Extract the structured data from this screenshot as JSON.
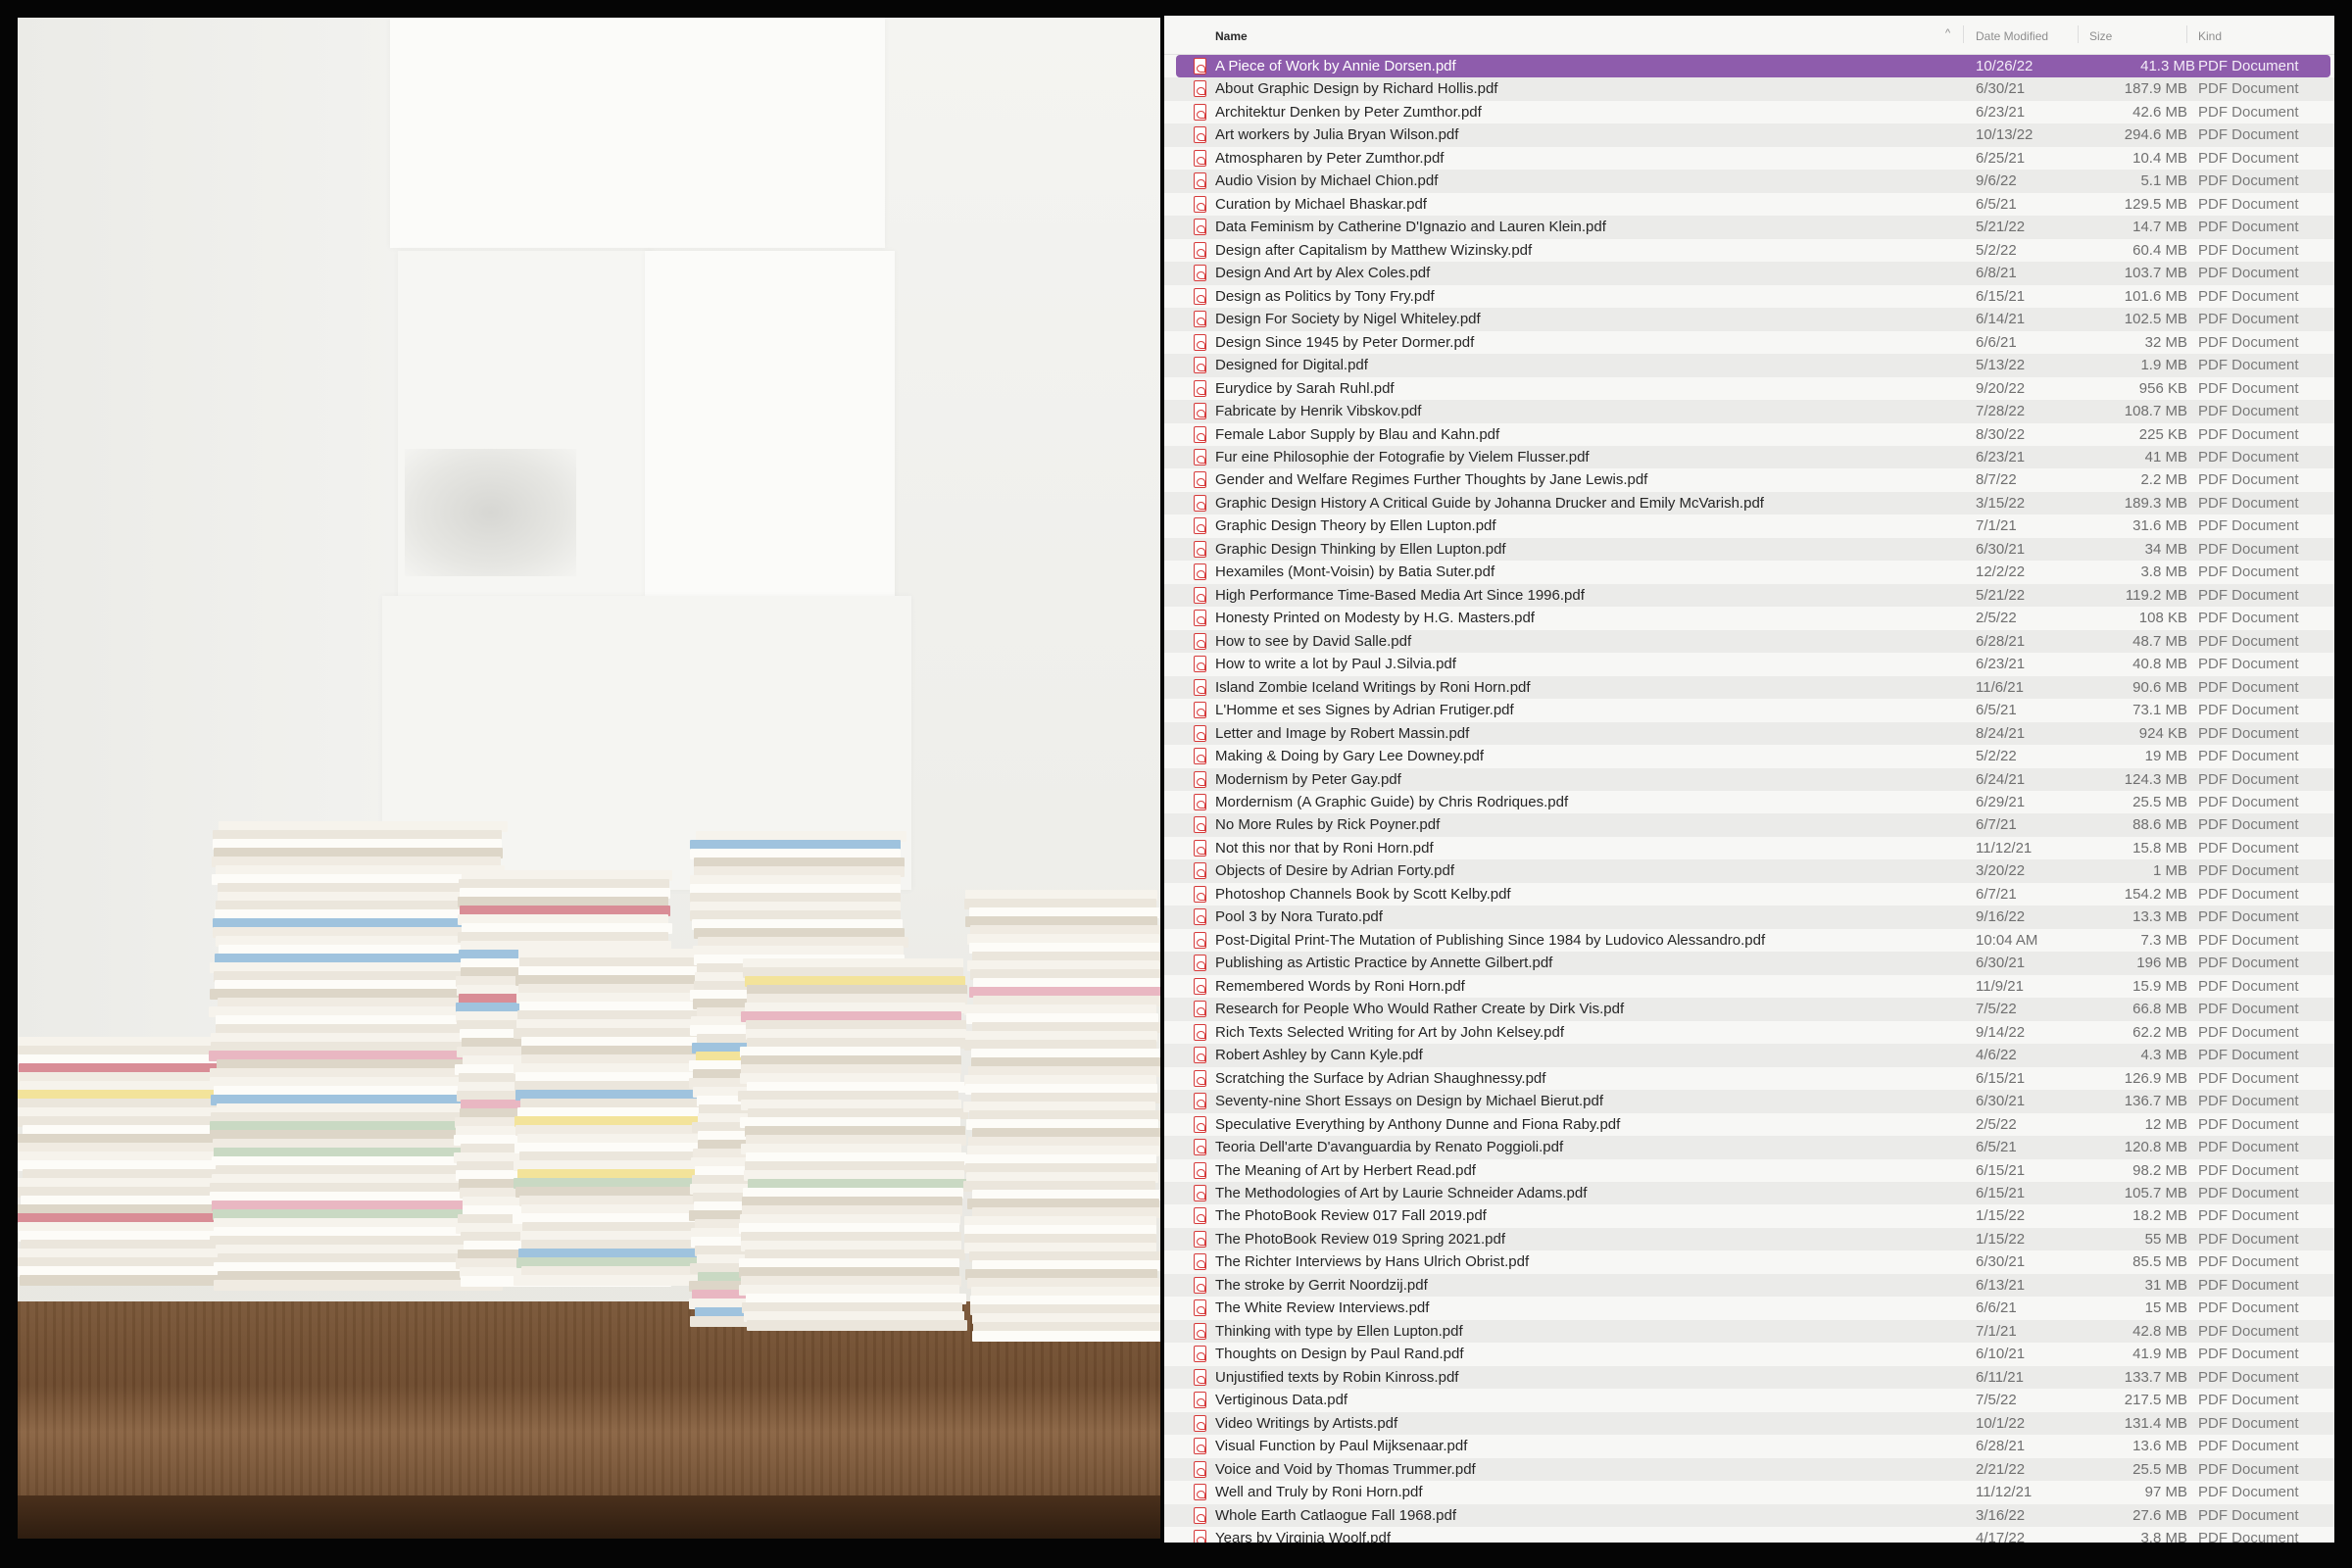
{
  "finder": {
    "columns": {
      "name": "Name",
      "date": "Date Modified",
      "size": "Size",
      "kind": "Kind",
      "sort_indicator": "^"
    },
    "colors": {
      "selection": "#8e5cac",
      "pdf_icon": "#d63a3a",
      "stripe": "#ebebe9"
    },
    "icon": "pdf-file-icon",
    "selected_index": 0,
    "files": [
      {
        "name": "A Piece of Work by Annie Dorsen.pdf",
        "date": "10/26/22",
        "size": "41.3 MB",
        "kind": "PDF Document"
      },
      {
        "name": "About Graphic Design by Richard Hollis.pdf",
        "date": "6/30/21",
        "size": "187.9 MB",
        "kind": "PDF Document"
      },
      {
        "name": "Architektur Denken by Peter Zumthor.pdf",
        "date": "6/23/21",
        "size": "42.6 MB",
        "kind": "PDF Document"
      },
      {
        "name": "Art workers by Julia Bryan Wilson.pdf",
        "date": "10/13/22",
        "size": "294.6 MB",
        "kind": "PDF Document"
      },
      {
        "name": "Atmospharen by Peter Zumthor.pdf",
        "date": "6/25/21",
        "size": "10.4 MB",
        "kind": "PDF Document"
      },
      {
        "name": "Audio Vision by Michael Chion.pdf",
        "date": "9/6/22",
        "size": "5.1 MB",
        "kind": "PDF Document"
      },
      {
        "name": "Curation by Michael Bhaskar.pdf",
        "date": "6/5/21",
        "size": "129.5 MB",
        "kind": "PDF Document"
      },
      {
        "name": "Data Feminism by Catherine D'Ignazio and Lauren Klein.pdf",
        "date": "5/21/22",
        "size": "14.7 MB",
        "kind": "PDF Document"
      },
      {
        "name": "Design after Capitalism by Matthew Wizinsky.pdf",
        "date": "5/2/22",
        "size": "60.4 MB",
        "kind": "PDF Document"
      },
      {
        "name": "Design And Art by Alex Coles.pdf",
        "date": "6/8/21",
        "size": "103.7 MB",
        "kind": "PDF Document"
      },
      {
        "name": "Design as Politics by Tony Fry.pdf",
        "date": "6/15/21",
        "size": "101.6 MB",
        "kind": "PDF Document"
      },
      {
        "name": "Design For Society by Nigel Whiteley.pdf",
        "date": "6/14/21",
        "size": "102.5 MB",
        "kind": "PDF Document"
      },
      {
        "name": "Design Since 1945 by Peter Dormer.pdf",
        "date": "6/6/21",
        "size": "32 MB",
        "kind": "PDF Document"
      },
      {
        "name": "Designed for Digital.pdf",
        "date": "5/13/22",
        "size": "1.9 MB",
        "kind": "PDF Document"
      },
      {
        "name": "Eurydice by Sarah Ruhl.pdf",
        "date": "9/20/22",
        "size": "956 KB",
        "kind": "PDF Document"
      },
      {
        "name": "Fabricate by Henrik Vibskov.pdf",
        "date": "7/28/22",
        "size": "108.7 MB",
        "kind": "PDF Document"
      },
      {
        "name": "Female Labor Supply by Blau and Kahn.pdf",
        "date": "8/30/22",
        "size": "225 KB",
        "kind": "PDF Document"
      },
      {
        "name": "Fur eine Philosophie der Fotografie by Vielem Flusser.pdf",
        "date": "6/23/21",
        "size": "41 MB",
        "kind": "PDF Document"
      },
      {
        "name": "Gender and Welfare Regimes Further Thoughts by Jane Lewis.pdf",
        "date": "8/7/22",
        "size": "2.2 MB",
        "kind": "PDF Document"
      },
      {
        "name": "Graphic Design History A Critical Guide by Johanna Drucker and Emily McVarish.pdf",
        "date": "3/15/22",
        "size": "189.3 MB",
        "kind": "PDF Document"
      },
      {
        "name": "Graphic Design Theory by Ellen Lupton.pdf",
        "date": "7/1/21",
        "size": "31.6 MB",
        "kind": "PDF Document"
      },
      {
        "name": "Graphic Design Thinking by Ellen Lupton.pdf",
        "date": "6/30/21",
        "size": "34 MB",
        "kind": "PDF Document"
      },
      {
        "name": "Hexamiles (Mont-Voisin) by Batia Suter.pdf",
        "date": "12/2/22",
        "size": "3.8 MB",
        "kind": "PDF Document"
      },
      {
        "name": "High Performance Time-Based Media Art Since 1996.pdf",
        "date": "5/21/22",
        "size": "119.2 MB",
        "kind": "PDF Document"
      },
      {
        "name": "Honesty Printed on Modesty by H.G. Masters.pdf",
        "date": "2/5/22",
        "size": "108 KB",
        "kind": "PDF Document"
      },
      {
        "name": "How to see by David Salle.pdf",
        "date": "6/28/21",
        "size": "48.7 MB",
        "kind": "PDF Document"
      },
      {
        "name": "How to write a lot by Paul J.Silvia.pdf",
        "date": "6/23/21",
        "size": "40.8 MB",
        "kind": "PDF Document"
      },
      {
        "name": "Island Zombie Iceland Writings by Roni Horn.pdf",
        "date": "11/6/21",
        "size": "90.6 MB",
        "kind": "PDF Document"
      },
      {
        "name": "L'Homme et ses Signes by Adrian Frutiger.pdf",
        "date": "6/5/21",
        "size": "73.1 MB",
        "kind": "PDF Document"
      },
      {
        "name": "Letter and Image by Robert Massin.pdf",
        "date": "8/24/21",
        "size": "924 KB",
        "kind": "PDF Document"
      },
      {
        "name": "Making & Doing by Gary Lee Downey.pdf",
        "date": "5/2/22",
        "size": "19 MB",
        "kind": "PDF Document"
      },
      {
        "name": "Modernism by Peter Gay.pdf",
        "date": "6/24/21",
        "size": "124.3 MB",
        "kind": "PDF Document"
      },
      {
        "name": "Mordernism (A Graphic Guide) by Chris Rodriques.pdf",
        "date": "6/29/21",
        "size": "25.5 MB",
        "kind": "PDF Document"
      },
      {
        "name": "No More Rules by Rick Poyner.pdf",
        "date": "6/7/21",
        "size": "88.6 MB",
        "kind": "PDF Document"
      },
      {
        "name": "Not this nor that by Roni Horn.pdf",
        "date": "11/12/21",
        "size": "15.8 MB",
        "kind": "PDF Document"
      },
      {
        "name": "Objects of Desire by Adrian Forty.pdf",
        "date": "3/20/22",
        "size": "1 MB",
        "kind": "PDF Document"
      },
      {
        "name": "Photoshop Channels Book by Scott Kelby.pdf",
        "date": "6/7/21",
        "size": "154.2 MB",
        "kind": "PDF Document"
      },
      {
        "name": "Pool 3 by Nora Turato.pdf",
        "date": "9/16/22",
        "size": "13.3 MB",
        "kind": "PDF Document"
      },
      {
        "name": "Post-Digital Print-The Mutation of Publishing Since 1984 by Ludovico Alessandro.pdf",
        "date": "10:04 AM",
        "size": "7.3 MB",
        "kind": "PDF Document"
      },
      {
        "name": "Publishing as Artistic Practice by Annette Gilbert.pdf",
        "date": "6/30/21",
        "size": "196 MB",
        "kind": "PDF Document"
      },
      {
        "name": "Remembered Words by Roni Horn.pdf",
        "date": "11/9/21",
        "size": "15.9 MB",
        "kind": "PDF Document"
      },
      {
        "name": "Research for People Who Would Rather Create by Dirk Vis.pdf",
        "date": "7/5/22",
        "size": "66.8 MB",
        "kind": "PDF Document"
      },
      {
        "name": "Rich Texts Selected Writing for Art by John Kelsey.pdf",
        "date": "9/14/22",
        "size": "62.2 MB",
        "kind": "PDF Document"
      },
      {
        "name": "Robert Ashley by Cann Kyle.pdf",
        "date": "4/6/22",
        "size": "4.3 MB",
        "kind": "PDF Document"
      },
      {
        "name": "Scratching the Surface by Adrian Shaughnessy.pdf",
        "date": "6/15/21",
        "size": "126.9 MB",
        "kind": "PDF Document"
      },
      {
        "name": "Seventy-nine Short Essays on Design by Michael Bierut.pdf",
        "date": "6/30/21",
        "size": "136.7 MB",
        "kind": "PDF Document"
      },
      {
        "name": "Speculative Everything by Anthony Dunne and Fiona Raby.pdf",
        "date": "2/5/22",
        "size": "12 MB",
        "kind": "PDF Document"
      },
      {
        "name": "Teoria Dell'arte D'avanguardia by Renato Poggioli.pdf",
        "date": "6/5/21",
        "size": "120.8 MB",
        "kind": "PDF Document"
      },
      {
        "name": "The Meaning of Art by Herbert Read.pdf",
        "date": "6/15/21",
        "size": "98.2 MB",
        "kind": "PDF Document"
      },
      {
        "name": "The Methodologies of Art by Laurie Schneider Adams.pdf",
        "date": "6/15/21",
        "size": "105.7 MB",
        "kind": "PDF Document"
      },
      {
        "name": "The PhotoBook Review 017 Fall 2019.pdf",
        "date": "1/15/22",
        "size": "18.2 MB",
        "kind": "PDF Document"
      },
      {
        "name": "The PhotoBook Review 019 Spring 2021.pdf",
        "date": "1/15/22",
        "size": "55 MB",
        "kind": "PDF Document"
      },
      {
        "name": "The Richter Interviews by Hans Ulrich Obrist.pdf",
        "date": "6/30/21",
        "size": "85.5 MB",
        "kind": "PDF Document"
      },
      {
        "name": "The stroke by Gerrit Noordzij.pdf",
        "date": "6/13/21",
        "size": "31 MB",
        "kind": "PDF Document"
      },
      {
        "name": "The White Review Interviews.pdf",
        "date": "6/6/21",
        "size": "15 MB",
        "kind": "PDF Document"
      },
      {
        "name": "Thinking with type by Ellen Lupton.pdf",
        "date": "7/1/21",
        "size": "42.8 MB",
        "kind": "PDF Document"
      },
      {
        "name": "Thoughts on Design by Paul Rand.pdf",
        "date": "6/10/21",
        "size": "41.9 MB",
        "kind": "PDF Document"
      },
      {
        "name": "Unjustified texts by Robin Kinross.pdf",
        "date": "6/11/21",
        "size": "133.7 MB",
        "kind": "PDF Document"
      },
      {
        "name": "Vertiginous Data.pdf",
        "date": "7/5/22",
        "size": "217.5 MB",
        "kind": "PDF Document"
      },
      {
        "name": "Video Writings by Artists.pdf",
        "date": "10/1/22",
        "size": "131.4 MB",
        "kind": "PDF Document"
      },
      {
        "name": "Visual Function by Paul Mijksenaar.pdf",
        "date": "6/28/21",
        "size": "13.6 MB",
        "kind": "PDF Document"
      },
      {
        "name": "Voice and Void by Thomas Trummer.pdf",
        "date": "2/21/22",
        "size": "25.5 MB",
        "kind": "PDF Document"
      },
      {
        "name": "Well and Truly by Roni Horn.pdf",
        "date": "11/12/21",
        "size": "97 MB",
        "kind": "PDF Document"
      },
      {
        "name": "Whole Earth Catlaogue Fall 1968.pdf",
        "date": "3/16/22",
        "size": "27.6 MB",
        "kind": "PDF Document"
      },
      {
        "name": "Years by Virginia Woolf.pdf",
        "date": "4/17/22",
        "size": "3.8 MB",
        "kind": "PDF Document"
      }
    ]
  }
}
